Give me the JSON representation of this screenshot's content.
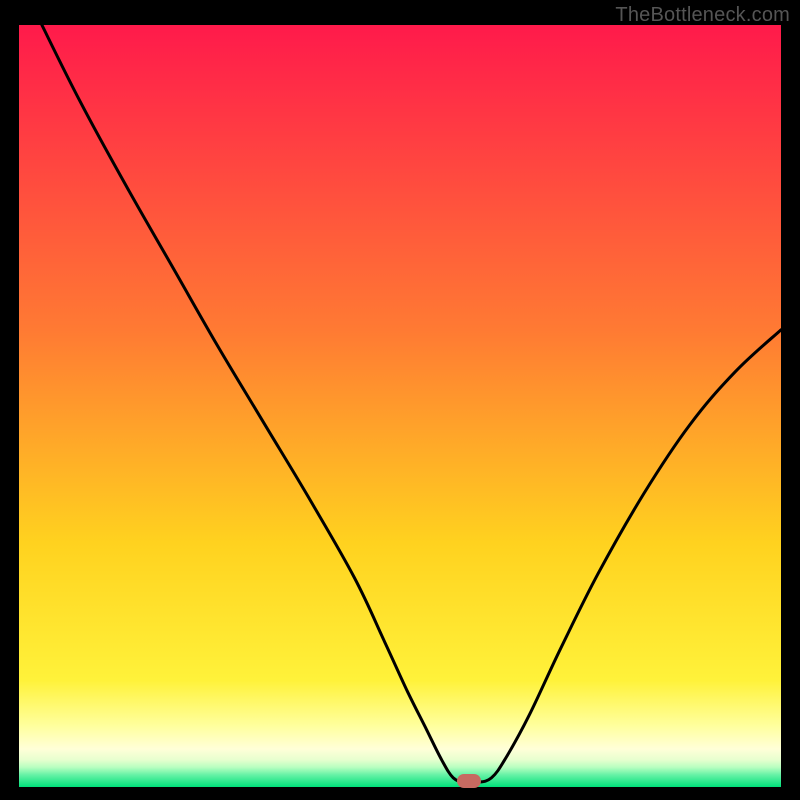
{
  "watermark": "TheBottleneck.com",
  "chart_data": {
    "type": "line",
    "title": "",
    "xlabel": "",
    "ylabel": "",
    "xlim": [
      0,
      100
    ],
    "ylim": [
      0,
      100
    ],
    "grid": false,
    "legend": false,
    "series": [
      {
        "name": "bottleneck-curve",
        "x": [
          3,
          8,
          14,
          20,
          26,
          32,
          38,
          44,
          48,
          51,
          53.5,
          55.5,
          57,
          58.5,
          60,
          62,
          64,
          67,
          71,
          76,
          82,
          88,
          94,
          100
        ],
        "y": [
          100,
          90,
          79,
          68.5,
          58,
          48,
          38,
          27.5,
          19,
          12.5,
          7.5,
          3.5,
          1.2,
          0.6,
          0.6,
          1.2,
          4,
          9.5,
          18,
          28,
          38.5,
          47.5,
          54.5,
          60
        ]
      }
    ],
    "marker": {
      "x": 59,
      "y": 0.8,
      "color": "#c76a61",
      "shape": "rounded-rect"
    },
    "background_gradient": {
      "stops": [
        {
          "y": 100,
          "color": "#ff1a4b"
        },
        {
          "y": 60,
          "color": "#ff7a33"
        },
        {
          "y": 32,
          "color": "#ffd21f"
        },
        {
          "y": 14,
          "color": "#fff23a"
        },
        {
          "y": 8,
          "color": "#ffff9e"
        },
        {
          "y": 5,
          "color": "#ffffd8"
        },
        {
          "y": 3.6,
          "color": "#e8ffcf"
        },
        {
          "y": 2.6,
          "color": "#b8ffc0"
        },
        {
          "y": 1.6,
          "color": "#66f2a6"
        },
        {
          "y": 0,
          "color": "#00e07a"
        }
      ]
    }
  },
  "colors": {
    "frame": "#000000",
    "curve": "#000000",
    "watermark": "#555555",
    "marker": "#c76a61"
  }
}
